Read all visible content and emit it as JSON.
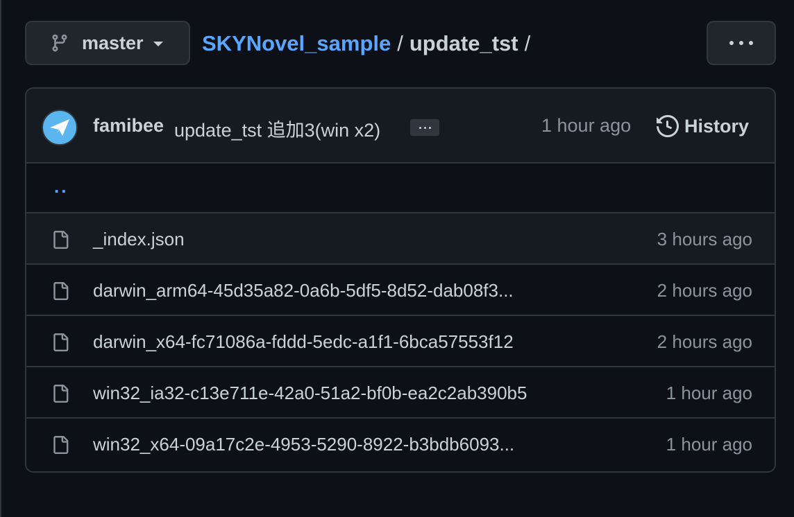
{
  "branch": {
    "name": "master"
  },
  "breadcrumb": {
    "repo": "SKYNovel_sample",
    "sep1": "/",
    "dir": "update_tst",
    "sep2": "/"
  },
  "commit": {
    "author": "famibee",
    "message": "update_tst 追加3(win x2)",
    "time": "1 hour ago",
    "history_label": "History"
  },
  "parent_link": "..",
  "files": [
    {
      "name": "_index.json",
      "time": "3 hours ago"
    },
    {
      "name": "darwin_arm64-45d35a82-0a6b-5df5-8d52-dab08f3...",
      "time": "2 hours ago"
    },
    {
      "name": "darwin_x64-fc71086a-fddd-5edc-a1f1-6bca57553f12",
      "time": "2 hours ago"
    },
    {
      "name": "win32_ia32-c13e711e-42a0-51a2-bf0b-ea2c2ab390b5",
      "time": "1 hour ago"
    },
    {
      "name": "win32_x64-09a17c2e-4953-5290-8922-b3bdb6093...",
      "time": "1 hour ago"
    }
  ],
  "icons": {
    "branch": "git-branch-icon",
    "more": "kebab-horizontal-icon",
    "history": "history-icon",
    "file": "file-icon",
    "avatar": "paper-plane-icon"
  },
  "colors": {
    "background": "#0d1117",
    "panel": "#161b22",
    "border": "#30363d",
    "link": "#58a6ff",
    "text": "#c9d1d9",
    "muted": "#8b949e"
  }
}
